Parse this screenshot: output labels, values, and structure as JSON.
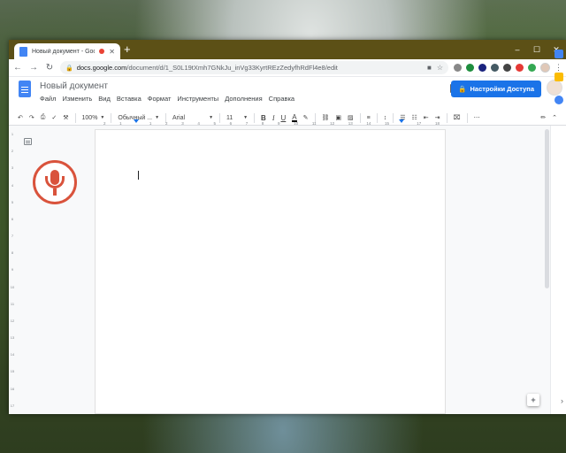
{
  "browser": {
    "tab": {
      "title": "Новый документ - Google Д"
    },
    "new_tab_label": "+",
    "window_controls": {
      "minimize": "–",
      "maximize": "☐",
      "close": "✕"
    },
    "address": {
      "domain": "docs.google.com",
      "path": "/document/d/1_S0L19tXmh7GNkJu_inVg33KyrtREzZedyfhRdFl4e8/edit"
    }
  },
  "doc": {
    "title": "Новый документ",
    "menu": [
      "Файл",
      "Изменить",
      "Вид",
      "Вставка",
      "Формат",
      "Инструменты",
      "Дополнения",
      "Справка"
    ],
    "share_label": "Настройки Доступа"
  },
  "toolbar": {
    "zoom": "100%",
    "style": "Обычный ...",
    "font": "Arial",
    "font_size": "11",
    "bold": "B",
    "italic": "I",
    "underline": "U",
    "text_color": "A"
  },
  "ruler": {
    "ticks": [
      "2",
      "1",
      "",
      "1",
      "2",
      "3",
      "4",
      "5",
      "6",
      "7",
      "8",
      "9",
      "10",
      "11",
      "12",
      "13",
      "14",
      "15",
      "",
      "17",
      "18"
    ],
    "vticks": [
      "1",
      "2",
      "3",
      "4",
      "5",
      "6",
      "7",
      "8",
      "9",
      "10",
      "11",
      "12",
      "13",
      "14",
      "15",
      "16",
      "17"
    ]
  },
  "colors": {
    "accent": "#1a73e8",
    "mic": "#d9533c",
    "titlebar": "#5c5016"
  }
}
